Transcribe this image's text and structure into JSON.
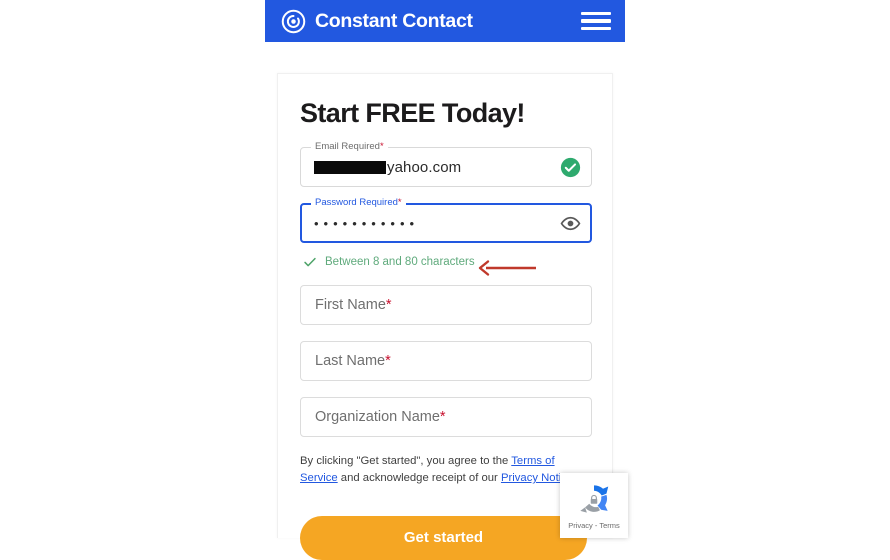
{
  "header": {
    "brand_name": "Constant Contact",
    "logo_icon": "constant-contact-swirl-icon",
    "menu_icon": "hamburger-menu-icon",
    "background_color": "#2258e0"
  },
  "card": {
    "title": "Start FREE Today!",
    "email_field": {
      "label": "Email Required",
      "required_marker": "*",
      "value_redacted": true,
      "value_visible": "yahoo.com",
      "status_icon": "green-check-circle-icon",
      "status_color": "#2eaa6e"
    },
    "password_field": {
      "label": "Password Required",
      "required_marker": "*",
      "value_masked": "•••••••••••",
      "focused": true,
      "focus_color": "#2258e0",
      "reveal_icon": "eye-icon"
    },
    "password_hint": {
      "check_icon": "green-check-icon",
      "text": "Between 8 and 80 characters",
      "color": "#5faa7c"
    },
    "annotation": {
      "type": "arrow-left",
      "color": "#c0392b"
    },
    "first_name_field": {
      "placeholder": "First Name",
      "required_marker": "*"
    },
    "last_name_field": {
      "placeholder": "Last Name",
      "required_marker": "*"
    },
    "organization_field": {
      "placeholder": "Organization Name",
      "required_marker": "*"
    },
    "legal": {
      "part1": "By clicking \"Get started\", you agree to the ",
      "terms_link": "Terms of Service",
      "part2": " and acknowledge receipt of our ",
      "privacy_link": "Privacy Notice"
    },
    "submit_button": {
      "label": "Get started",
      "color": "#f5a623"
    }
  },
  "recaptcha": {
    "logo_icon": "recaptcha-logo-icon",
    "caption": "Privacy - Terms"
  }
}
